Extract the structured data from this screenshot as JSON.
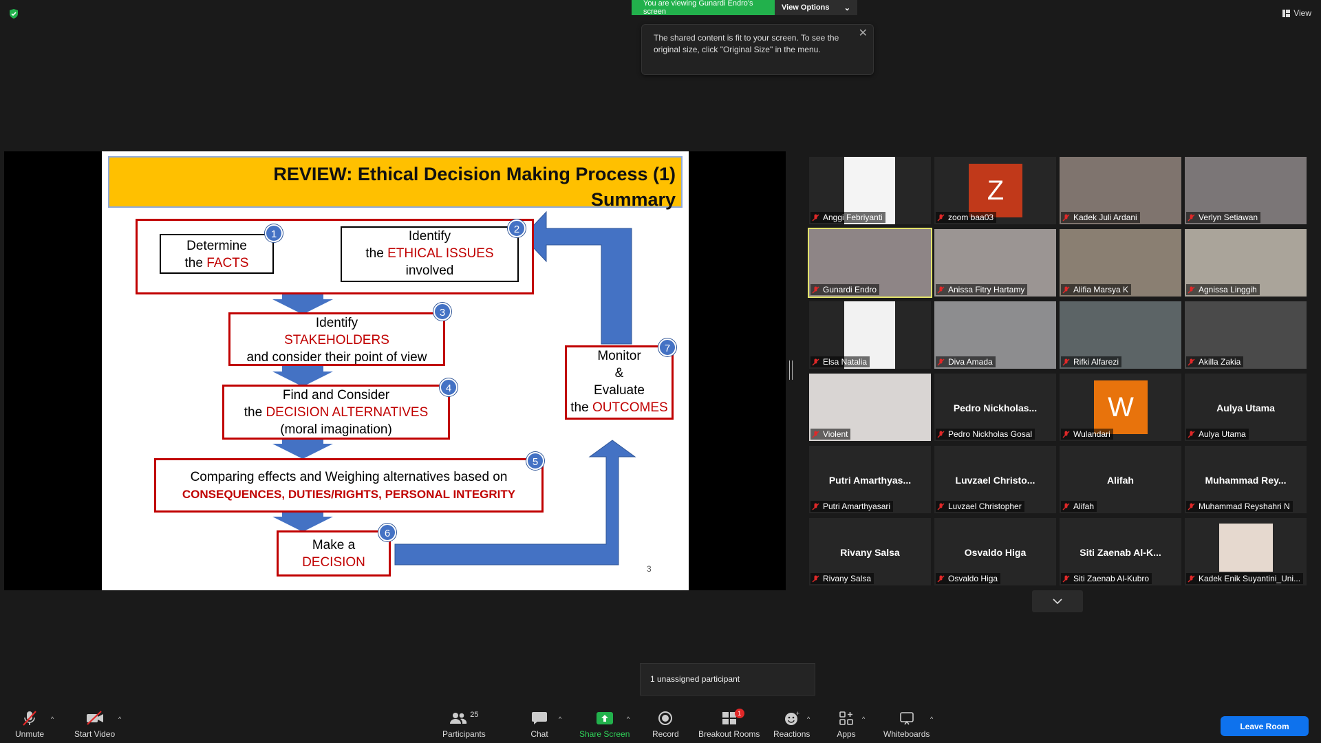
{
  "top": {
    "banner_text": "You are viewing Gunardi Endro's screen",
    "view_options_label": "View Options",
    "tooltip_text": "The shared content is fit to your screen. To see the original size, click \"Original Size\" in the menu.",
    "view_label": "View"
  },
  "slide": {
    "title_line1": "REVIEW: Ethical Decision Making Process (1)",
    "title_line2": "Summary",
    "box1_line1": "Determine",
    "box1_line2a": "the ",
    "box1_line2b": "FACTS",
    "box2_line1": "Identify",
    "box2_line2a": "the ",
    "box2_line2b": "ETHICAL ISSUES",
    "box2_line3": "involved",
    "box3_line1": "Identify",
    "box3_line2": "STAKEHOLDERS",
    "box3_line3": "and consider their point of view",
    "box4_line1": "Find and Consider",
    "box4_line2a": "the ",
    "box4_line2b": "DECISION ALTERNATIVES",
    "box4_line3": "(moral imagination)",
    "box5_line1": "Comparing effects and Weighing  alternatives based on",
    "box5_line2": "CONSEQUENCES, DUTIES/RIGHTS, PERSONAL INTEGRITY",
    "box6_line1": "Make a",
    "box6_line2": "DECISION",
    "box7_line1": "Monitor",
    "box7_line2": "&",
    "box7_line3": "Evaluate",
    "box7_line4a": "the ",
    "box7_line4b": "OUTCOMES",
    "badges": [
      "1",
      "2",
      "3",
      "4",
      "5",
      "6",
      "7"
    ],
    "page_number": "3"
  },
  "participants": [
    {
      "label": "Anggi Febriyanti"
    },
    {
      "label": "zoom baa03",
      "initial": "Z",
      "color": "#c1391a"
    },
    {
      "label": "Kadek Juli Ardani"
    },
    {
      "label": "Verlyn Setiawan"
    },
    {
      "label": "Gunardi Endro"
    },
    {
      "label": "Anissa Fitry Hartamy"
    },
    {
      "label": "Alifia Marsya K"
    },
    {
      "label": "Agnissa Linggih"
    },
    {
      "label": "Elsa Natalia"
    },
    {
      "label": "Diva Amada"
    },
    {
      "label": "Rifki Alfarezi"
    },
    {
      "label": "Akilla Zakia"
    },
    {
      "label": "Violent"
    },
    {
      "label": "Pedro Nickholas Gosal",
      "display": "Pedro  Nickholas..."
    },
    {
      "label": "Wulandari",
      "initial": "W",
      "color": "#e8730c"
    },
    {
      "label": "Aulya Utama",
      "display": "Aulya Utama"
    },
    {
      "label": "Putri Amarthyasari",
      "display": "Putri  Amarthyas..."
    },
    {
      "label": "Luvzael Christopher",
      "display": "Luvzael  Christo..."
    },
    {
      "label": "Alifah",
      "display": "Alifah"
    },
    {
      "label": "Muhammad Reyshahri N",
      "display": "Muhammad  Rey..."
    },
    {
      "label": "Rivany Salsa",
      "display": "Rivany Salsa"
    },
    {
      "label": "Osvaldo Higa",
      "display": "Osvaldo Higa"
    },
    {
      "label": "Siti Zaenab Al-Kubro",
      "display": "Siti  Zaenab  Al-K..."
    },
    {
      "label": "Kadek Enik Suyantini_Uni..."
    }
  ],
  "unassigned_text": "1 unassigned participant",
  "toolbar": {
    "unmute": "Unmute",
    "start_video": "Start Video",
    "participants": "Participants",
    "participants_count": "25",
    "chat": "Chat",
    "share_screen": "Share Screen",
    "record": "Record",
    "breakout_rooms": "Breakout Rooms",
    "breakout_badge": "1",
    "reactions": "Reactions",
    "apps": "Apps",
    "whiteboards": "Whiteboards",
    "leave_room": "Leave Room"
  },
  "colors": {
    "share_green": "#22b14c",
    "active_speaker": "#e3e36b",
    "leave_blue": "#0e72ed",
    "slide_title_bg": "#ffc000",
    "slide_red": "#c00000",
    "flow_blue": "#4472c4"
  }
}
